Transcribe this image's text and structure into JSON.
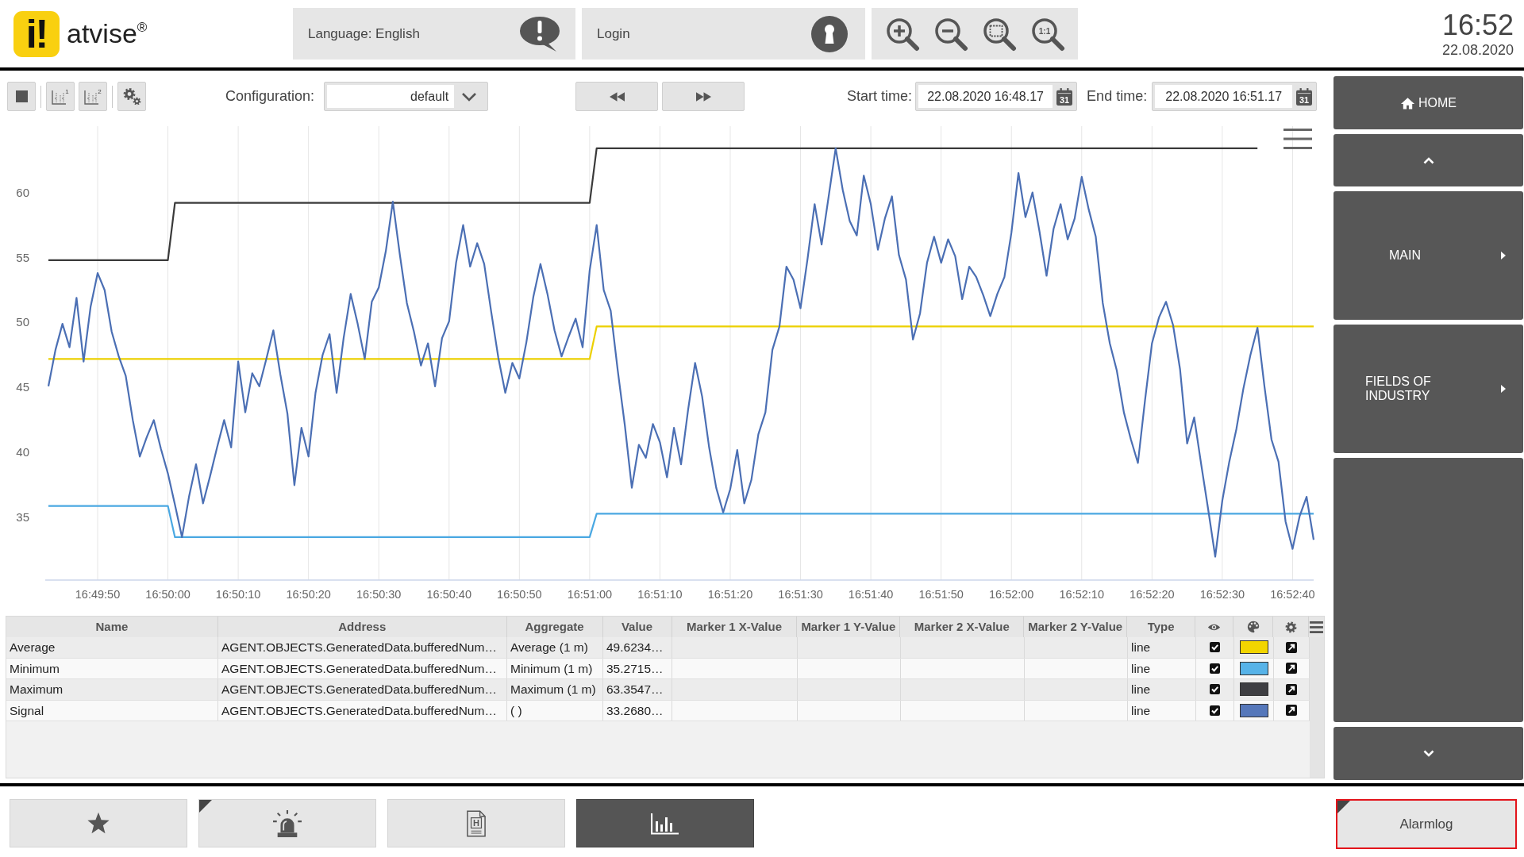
{
  "header": {
    "logo": {
      "mark": "i!",
      "name": "atvise$^{®}$"
    },
    "language_button": {
      "label": "Language: English"
    },
    "login_button": {
      "label": "Login"
    },
    "zoom_buttons": [
      {
        "kind": "zoom-in"
      },
      {
        "kind": "zoom-out"
      },
      {
        "kind": "zoom-area"
      },
      {
        "kind": "zoom-reset",
        "icon_text": "1:1"
      }
    ],
    "clock": {
      "time": "16:52",
      "date": "22.08.2020"
    }
  },
  "toolbar": {
    "buttons": [
      {
        "kind": "stop"
      },
      {
        "kind": "axis",
        "icon_text": "1"
      },
      {
        "kind": "axis",
        "icon_text": "2"
      },
      {
        "kind": "settings"
      }
    ],
    "configuration": {
      "label": "Configuration:",
      "value": "default"
    },
    "navigation": [
      {
        "kind": "back"
      },
      {
        "kind": "forward"
      }
    ],
    "start_time": {
      "label": "Start time:",
      "value": "22.08.2020 16:48.17",
      "icon_text": "31"
    },
    "end_time": {
      "label": "End time:",
      "value": "22.08.2020 16:51.17",
      "icon_text": "31"
    }
  },
  "chart": {
    "chart_data": {
      "type": "line",
      "categories": [
        null,
        null,
        null,
        null,
        null,
        null,
        null,
        "16:49:50",
        null,
        null,
        null,
        null,
        null,
        null,
        null,
        null,
        null,
        "16:50:00",
        null,
        null,
        null,
        null,
        null,
        null,
        null,
        null,
        null,
        "16:50:10",
        null,
        null,
        null,
        null,
        null,
        null,
        null,
        null,
        null,
        "16:50:20",
        null,
        null,
        null,
        null,
        null,
        null,
        null,
        null,
        null,
        "16:50:30",
        null,
        null,
        null,
        null,
        null,
        null,
        null,
        null,
        null,
        "16:50:40",
        null,
        null,
        null,
        null,
        null,
        null,
        null,
        null,
        null,
        "16:50:50",
        null,
        null,
        null,
        null,
        null,
        null,
        null,
        null,
        null,
        "16:51:00",
        null,
        null,
        null,
        null,
        null,
        null,
        null,
        null,
        null,
        "16:51:10",
        null,
        null,
        null,
        null,
        null,
        null,
        null,
        null,
        null,
        "16:51:20",
        null,
        null,
        null,
        null,
        null,
        null,
        null,
        null,
        null,
        "16:51:30",
        null,
        null,
        null,
        null,
        null,
        null,
        null,
        null,
        null,
        "16:51:40",
        null,
        null,
        null,
        null,
        null,
        null,
        null,
        null,
        null,
        "16:51:50",
        null,
        null,
        null,
        null,
        null,
        null,
        null,
        null,
        null,
        "16:52:00",
        null,
        null,
        null,
        null,
        null,
        null,
        null,
        null,
        null,
        "16:52:10",
        null,
        null,
        null,
        null,
        null,
        null,
        null,
        null,
        null,
        "16:52:20",
        null,
        null,
        null,
        null,
        null,
        null,
        null,
        null,
        null,
        "16:52:30",
        null,
        null,
        null,
        null,
        null,
        null,
        null,
        null,
        null,
        "16:52:40",
        null,
        null,
        null
      ],
      "ylim": [
        30.2,
        65.1
      ],
      "yticks": [
        35,
        40,
        45,
        50,
        55,
        60
      ],
      "series": [
        {
          "color": "#ecd000",
          "values": [
            47.2,
            47.2,
            47.2,
            47.2,
            47.2,
            47.2,
            47.2,
            47.2,
            47.2,
            47.2,
            47.2,
            47.2,
            47.2,
            47.2,
            47.2,
            47.2,
            47.2,
            47.2,
            47.2,
            47.2,
            47.2,
            47.2,
            47.2,
            47.2,
            47.2,
            47.2,
            47.2,
            47.2,
            47.2,
            47.2,
            47.2,
            47.2,
            47.2,
            47.2,
            47.2,
            47.2,
            47.2,
            47.2,
            47.2,
            47.2,
            47.2,
            47.2,
            47.2,
            47.2,
            47.2,
            47.2,
            47.2,
            47.2,
            47.2,
            47.2,
            47.2,
            47.2,
            47.2,
            47.2,
            47.2,
            47.2,
            47.2,
            47.2,
            47.2,
            47.2,
            47.2,
            47.2,
            47.2,
            47.2,
            47.2,
            47.2,
            47.2,
            47.2,
            47.2,
            47.2,
            47.2,
            47.2,
            47.2,
            47.2,
            47.2,
            47.2,
            47.2,
            47.2,
            49.7,
            49.7,
            49.7,
            49.7,
            49.7,
            49.7,
            49.7,
            49.7,
            49.7,
            49.7,
            49.7,
            49.7,
            49.7,
            49.7,
            49.7,
            49.7,
            49.7,
            49.7,
            49.7,
            49.7,
            49.7,
            49.7,
            49.7,
            49.7,
            49.7,
            49.7,
            49.7,
            49.7,
            49.7,
            49.7,
            49.7,
            49.7,
            49.7,
            49.7,
            49.7,
            49.7,
            49.7,
            49.7,
            49.7,
            49.7,
            49.7,
            49.7,
            49.7,
            49.7,
            49.7,
            49.7,
            49.7,
            49.7,
            49.7,
            49.7,
            49.7,
            49.7,
            49.7,
            49.7,
            49.7,
            49.7,
            49.7,
            49.7,
            49.7,
            49.7,
            49.7,
            49.7,
            49.7,
            49.7,
            49.7,
            49.7,
            49.7,
            49.7,
            49.7,
            49.7,
            49.7,
            49.7,
            49.7,
            49.7,
            49.7,
            49.7,
            49.7,
            49.7,
            49.7,
            49.7,
            49.7,
            49.7,
            49.7,
            49.7,
            49.7,
            49.7,
            49.7,
            49.7,
            49.7,
            49.7,
            49.7,
            49.7,
            49.7,
            49.7,
            49.7,
            49.7,
            49.7,
            49.7,
            49.7,
            49.7,
            49.7,
            49.7,
            49.7
          ]
        },
        {
          "color": "#4aa8e2",
          "values": [
            35.9,
            35.9,
            35.9,
            35.9,
            35.9,
            35.9,
            35.9,
            35.9,
            35.9,
            35.9,
            35.9,
            35.9,
            35.9,
            35.9,
            35.9,
            35.9,
            35.9,
            35.9,
            33.5,
            33.5,
            33.5,
            33.5,
            33.5,
            33.5,
            33.5,
            33.5,
            33.5,
            33.5,
            33.5,
            33.5,
            33.5,
            33.5,
            33.5,
            33.5,
            33.5,
            33.5,
            33.5,
            33.5,
            33.5,
            33.5,
            33.5,
            33.5,
            33.5,
            33.5,
            33.5,
            33.5,
            33.5,
            33.5,
            33.5,
            33.5,
            33.5,
            33.5,
            33.5,
            33.5,
            33.5,
            33.5,
            33.5,
            33.5,
            33.5,
            33.5,
            33.5,
            33.5,
            33.5,
            33.5,
            33.5,
            33.5,
            33.5,
            33.5,
            33.5,
            33.5,
            33.5,
            33.5,
            33.5,
            33.5,
            33.5,
            33.5,
            33.5,
            33.5,
            35.3,
            35.3,
            35.3,
            35.3,
            35.3,
            35.3,
            35.3,
            35.3,
            35.3,
            35.3,
            35.3,
            35.3,
            35.3,
            35.3,
            35.3,
            35.3,
            35.3,
            35.3,
            35.3,
            35.3,
            35.3,
            35.3,
            35.3,
            35.3,
            35.3,
            35.3,
            35.3,
            35.3,
            35.3,
            35.3,
            35.3,
            35.3,
            35.3,
            35.3,
            35.3,
            35.3,
            35.3,
            35.3,
            35.3,
            35.3,
            35.3,
            35.3,
            35.3,
            35.3,
            35.3,
            35.3,
            35.3,
            35.3,
            35.3,
            35.3,
            35.3,
            35.3,
            35.3,
            35.3,
            35.3,
            35.3,
            35.3,
            35.3,
            35.3,
            35.3,
            35.3,
            35.3,
            35.3,
            35.3,
            35.3,
            35.3,
            35.3,
            35.3,
            35.3,
            35.3,
            35.3,
            35.3,
            35.3,
            35.3,
            35.3,
            35.3,
            35.3,
            35.3,
            35.3,
            35.3,
            35.3,
            35.3,
            35.3,
            35.3,
            35.3,
            35.3,
            35.3,
            35.3,
            35.3,
            35.3,
            35.3,
            35.3,
            35.3,
            35.3,
            35.3,
            35.3,
            35.3,
            35.3,
            35.3,
            35.3,
            35.3,
            35.3,
            35.3
          ]
        },
        {
          "color": "#3a3a3a",
          "values": [
            54.8,
            54.8,
            54.8,
            54.8,
            54.8,
            54.8,
            54.8,
            54.8,
            54.8,
            54.8,
            54.8,
            54.8,
            54.8,
            54.8,
            54.8,
            54.8,
            54.8,
            54.8,
            59.2,
            59.2,
            59.2,
            59.2,
            59.2,
            59.2,
            59.2,
            59.2,
            59.2,
            59.2,
            59.2,
            59.2,
            59.2,
            59.2,
            59.2,
            59.2,
            59.2,
            59.2,
            59.2,
            59.2,
            59.2,
            59.2,
            59.2,
            59.2,
            59.2,
            59.2,
            59.2,
            59.2,
            59.2,
            59.2,
            59.2,
            59.2,
            59.2,
            59.2,
            59.2,
            59.2,
            59.2,
            59.2,
            59.2,
            59.2,
            59.2,
            59.2,
            59.2,
            59.2,
            59.2,
            59.2,
            59.2,
            59.2,
            59.2,
            59.2,
            59.2,
            59.2,
            59.2,
            59.2,
            59.2,
            59.2,
            59.2,
            59.2,
            59.2,
            59.2,
            63.4,
            63.4,
            63.4,
            63.4,
            63.4,
            63.4,
            63.4,
            63.4,
            63.4,
            63.4,
            63.4,
            63.4,
            63.4,
            63.4,
            63.4,
            63.4,
            63.4,
            63.4,
            63.4,
            63.4,
            63.4,
            63.4,
            63.4,
            63.4,
            63.4,
            63.4,
            63.4,
            63.4,
            63.4,
            63.4,
            63.4,
            63.4,
            63.4,
            63.4,
            63.4,
            63.4,
            63.4,
            63.4,
            63.4,
            63.4,
            63.4,
            63.4,
            63.4,
            63.4,
            63.4,
            63.4,
            63.4,
            63.4,
            63.4,
            63.4,
            63.4,
            63.4,
            63.4,
            63.4,
            63.4,
            63.4,
            63.4,
            63.4,
            63.4,
            63.4,
            63.4,
            63.4,
            63.4,
            63.4,
            63.4,
            63.4,
            63.4,
            63.4,
            63.4,
            63.4,
            63.4,
            63.4,
            63.4,
            63.4,
            63.4,
            63.4,
            63.4,
            63.4,
            63.4,
            63.4,
            63.4,
            63.4,
            63.4,
            63.4,
            63.4,
            63.4,
            63.4,
            63.4,
            63.4,
            63.4,
            63.4,
            63.4,
            63.4,
            63.4,
            63.4,
            null,
            null,
            null,
            null,
            null,
            null,
            null,
            null
          ]
        },
        {
          "color": "#4b6fb4",
          "values": [
            45.1,
            47.9,
            49.9,
            48.1,
            51.9,
            47.0,
            51.2,
            53.8,
            52.5,
            49.3,
            47.4,
            45.9,
            42.5,
            39.7,
            41.2,
            42.5,
            40.3,
            38.4,
            36.0,
            33.5,
            36.6,
            39.1,
            36.1,
            38.2,
            40.4,
            42.5,
            40.4,
            47.0,
            43.1,
            46.1,
            45.1,
            47.2,
            49.4,
            46.0,
            43.0,
            37.5,
            41.9,
            39.7,
            44.6,
            47.5,
            49.1,
            44.6,
            48.8,
            52.2,
            49.9,
            47.2,
            51.6,
            52.7,
            55.5,
            59.3,
            55.2,
            51.5,
            49.3,
            46.7,
            48.4,
            45.1,
            48.8,
            50.1,
            54.6,
            57.5,
            54.3,
            56.1,
            54.5,
            50.8,
            47.3,
            44.6,
            46.9,
            45.7,
            48.5,
            52.0,
            54.5,
            52.2,
            49.4,
            47.4,
            48.9,
            50.3,
            48.1,
            54.0,
            57.5,
            52.5,
            50.9,
            46.3,
            42.1,
            37.3,
            40.6,
            39.6,
            42.2,
            40.8,
            38.1,
            41.9,
            39.1,
            43.3,
            46.9,
            44.3,
            40.4,
            37.3,
            35.4,
            37.2,
            40.2,
            36.1,
            37.9,
            41.4,
            43.1,
            47.9,
            49.7,
            54.3,
            53.3,
            51.1,
            54.9,
            59.1,
            56.0,
            59.7,
            63.4,
            60.2,
            57.8,
            56.7,
            61.3,
            59.1,
            55.6,
            58.0,
            59.7,
            55.2,
            53.3,
            48.7,
            50.7,
            54.6,
            56.6,
            54.6,
            56.4,
            55.1,
            51.8,
            54.3,
            53.5,
            52.1,
            50.5,
            52.2,
            53.5,
            56.9,
            61.5,
            58.1,
            60.0,
            57.0,
            53.6,
            57.2,
            59.1,
            56.4,
            58.0,
            61.2,
            58.7,
            56.6,
            51.5,
            48.4,
            46.3,
            43.1,
            41.0,
            39.2,
            44.0,
            48.4,
            50.4,
            51.6,
            49.8,
            46.4,
            40.7,
            42.7,
            39.1,
            35.6,
            32.0,
            36.3,
            39.3,
            41.8,
            44.9,
            47.5,
            49.6,
            45.1,
            41.0,
            39.3,
            34.7,
            32.6,
            35.1,
            36.6,
            33.3
          ]
        }
      ]
    }
  },
  "table": {
    "columns": [
      {
        "kind": "text",
        "label": "Name"
      },
      {
        "kind": "text",
        "label": "Address"
      },
      {
        "kind": "text",
        "label": "Aggregate"
      },
      {
        "kind": "text",
        "label": "Value"
      },
      {
        "kind": "text",
        "label": "Marker 1 X-Value"
      },
      {
        "kind": "text",
        "label": "Marker 1 Y-Value"
      },
      {
        "kind": "text",
        "label": "Marker 2 X-Value"
      },
      {
        "kind": "text",
        "label": "Marker 2 Y-Value"
      },
      {
        "kind": "text",
        "label": "Type"
      },
      {
        "kind": "visible"
      },
      {
        "kind": "color"
      },
      {
        "kind": "settings"
      }
    ],
    "rows": [
      {
        "name": "Average",
        "address": "AGENT.OBJECTS.GeneratedData.bufferedNum…",
        "aggregate": "Average (1 m)",
        "value": "49.6234…",
        "type": "line",
        "visible": true,
        "color": "#f2d500"
      },
      {
        "name": "Minimum",
        "address": "AGENT.OBJECTS.GeneratedData.bufferedNum…",
        "aggregate": "Minimum (1 m)",
        "value": "35.2715…",
        "type": "line",
        "visible": true,
        "color": "#57b3e8"
      },
      {
        "name": "Maximum",
        "address": "AGENT.OBJECTS.GeneratedData.bufferedNum…",
        "aggregate": "Maximum (1 m)",
        "value": "63.3547…",
        "type": "line",
        "visible": true,
        "color": "#3e3e42"
      },
      {
        "name": "Signal",
        "address": "AGENT.OBJECTS.GeneratedData.bufferedNum…",
        "aggregate": "( )",
        "value": "33.2680…",
        "type": "line",
        "visible": true,
        "color": "#5577ba"
      }
    ]
  },
  "sidebar": {
    "items": [
      {
        "kind": "home",
        "label": "HOME"
      },
      {
        "kind": "up"
      },
      {
        "kind": "menu",
        "label": "MAIN",
        "submenu": true
      },
      {
        "kind": "menu",
        "label": "FIELDS OF INDUSTRY",
        "submenu": true
      },
      {
        "kind": "blank"
      },
      {
        "kind": "down"
      }
    ]
  },
  "footer": {
    "buttons": [
      {
        "kind": "favorites",
        "selected": false,
        "marked": false
      },
      {
        "kind": "alarms",
        "selected": false,
        "marked": true
      },
      {
        "kind": "report",
        "selected": false,
        "marked": false,
        "icon_text": "H"
      },
      {
        "kind": "trend",
        "selected": true,
        "marked": false
      }
    ],
    "alarmlog": {
      "label": "Alarmlog",
      "marked": true,
      "alert": true
    }
  }
}
